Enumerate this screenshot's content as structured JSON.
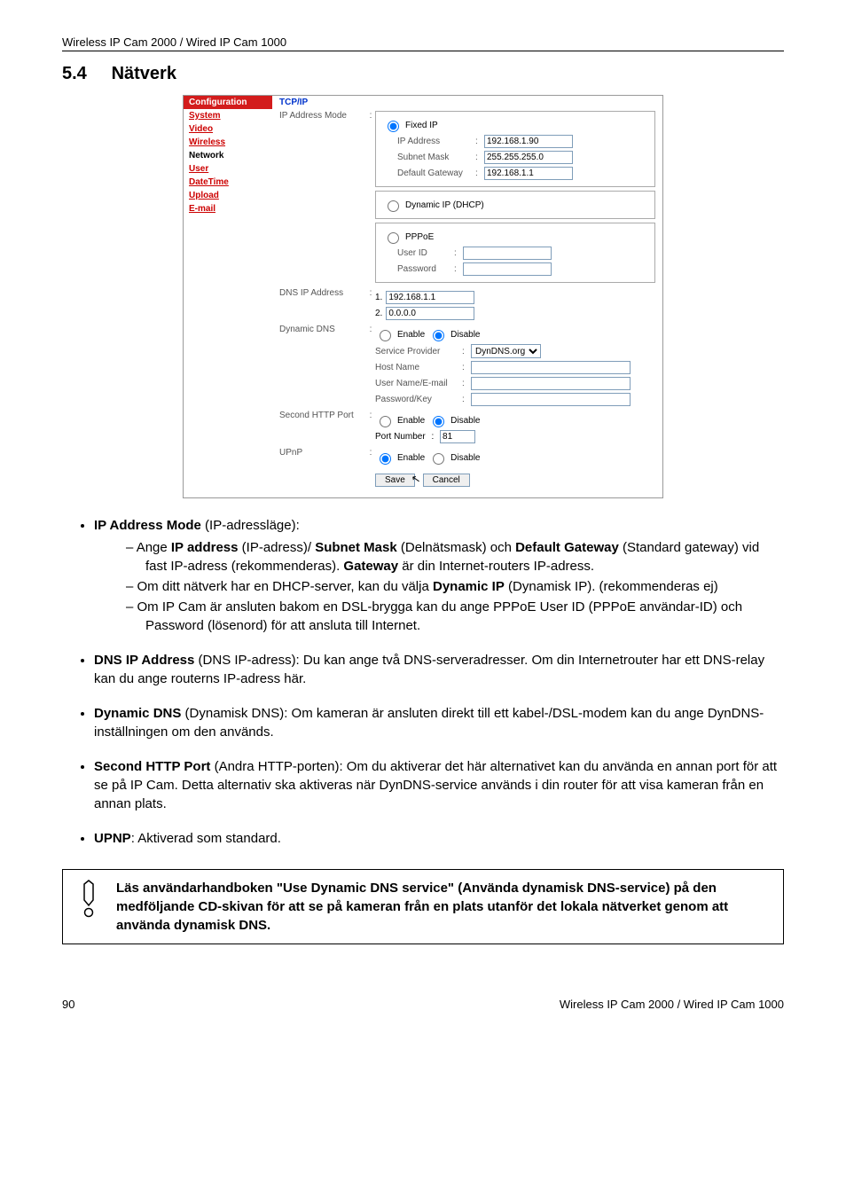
{
  "header": "Wireless IP Cam 2000 / Wired IP Cam 1000",
  "section": {
    "num": "5.4",
    "title": "Nätverk"
  },
  "cfg": {
    "sidebar_title": "Configuration",
    "sidebar": [
      {
        "label": "System",
        "active": false
      },
      {
        "label": "Video",
        "active": false
      },
      {
        "label": "Wireless",
        "active": false
      },
      {
        "label": "Network",
        "active": true
      },
      {
        "label": "User",
        "active": false
      },
      {
        "label": "DateTime",
        "active": false
      },
      {
        "label": "Upload",
        "active": false
      },
      {
        "label": "E-mail",
        "active": false
      }
    ],
    "tcp_title": "TCP/IP",
    "ip_mode_label": "IP Address Mode",
    "fixed_ip_label": "Fixed IP",
    "ip_address_label": "IP Address",
    "ip_address_value": "192.168.1.90",
    "subnet_label": "Subnet Mask",
    "subnet_value": "255.255.255.0",
    "gateway_label": "Default Gateway",
    "gateway_value": "192.168.1.1",
    "dhcp_label": "Dynamic IP (DHCP)",
    "pppoe_label": "PPPoE",
    "userid_label": "User ID",
    "userid_value": "",
    "password_label": "Password",
    "password_value": "",
    "dns_label": "DNS IP Address",
    "dns1_label": "1.",
    "dns1_value": "192.168.1.1",
    "dns2_label": "2.",
    "dns2_value": "0.0.0.0",
    "dyndns_label": "Dynamic DNS",
    "enable_label": "Enable",
    "disable_label": "Disable",
    "service_provider_label": "Service Provider",
    "service_provider_value": "DynDNS.org",
    "hostname_label": "Host Name",
    "hostname_value": "",
    "username_email_label": "User Name/E-mail",
    "username_email_value": "",
    "password_key_label": "Password/Key",
    "password_key_value": "",
    "second_http_label": "Second HTTP Port",
    "port_number_label": "Port Number",
    "port_number_value": "81",
    "upnp_label": "UPnP",
    "save_btn": "Save",
    "cancel_btn": "Cancel"
  },
  "body": {
    "ip_mode_heading": "IP Address Mode",
    "ip_mode_trans": "(IP-adressläge):",
    "sub1_a": "Ange ",
    "sub1_ip": "IP address",
    "sub1_b": " (IP-adress)/ ",
    "sub1_subnet": "Subnet Mask",
    "sub1_c": " (Delnätsmask) och ",
    "sub1_dg": "Default Gateway",
    "sub1_d": " (Standard gateway)  vid fast IP-adress (rekommenderas). ",
    "sub1_gw": "Gateway",
    "sub1_e": " är din Internet-routers IP-adress.",
    "sub2_a": "Om ditt nätverk har en DHCP-server, kan du välja ",
    "sub2_dyn": "Dynamic IP",
    "sub2_b": " (Dynamisk IP). (rekommenderas ej)",
    "sub3": "Om IP Cam är ansluten bakom en DSL-brygga kan du ange PPPoE User ID (PPPoE användar-ID) och Password (lösenord) för att ansluta till Internet.",
    "dns_heading": "DNS IP Address",
    "dns_text": " (DNS IP-adress): Du kan ange två DNS-serveradresser. Om din Internetrouter har ett DNS-relay kan du ange routerns IP-adress här.",
    "dyn_heading": "Dynamic DNS",
    "dyn_text": " (Dynamisk DNS): Om kameran är ansluten direkt till ett kabel-/DSL-modem kan du ange DynDNS-inställningen om den används.",
    "http_heading": "Second HTTP Port",
    "http_text": " (Andra HTTP-porten): Om du aktiverar det här alternativet kan du använda en annan port för att se på IP Cam. Detta alternativ ska aktiveras när DynDNS-service används i din router för att visa kameran från en annan plats.",
    "upnp_heading": "UPNP",
    "upnp_text": ": Aktiverad som standard.",
    "note": "Läs användarhandboken \"Use Dynamic DNS service\" (Använda dynamisk DNS-service) på den medföljande CD-skivan för att se på kameran från en plats utanför det lokala nätverket genom att använda dynamisk DNS."
  },
  "footer": {
    "page": "90",
    "right": "Wireless IP Cam 2000 / Wired IP Cam 1000"
  }
}
